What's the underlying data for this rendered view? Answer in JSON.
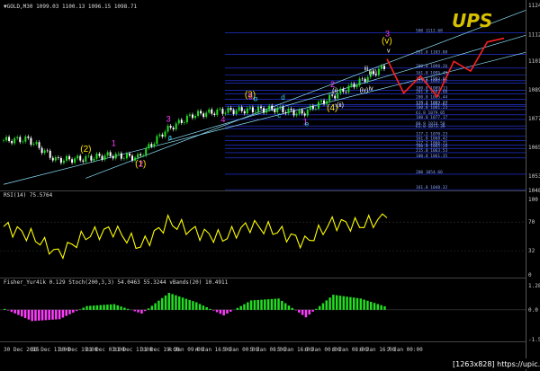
{
  "header": {
    "symbol": "▼GOLD,M30 1099.03 1100.13 1096.15 1098.71"
  },
  "logo": "UPS",
  "watermark": "[1263x828] https://upic.me",
  "colors": {
    "background": "#000000",
    "candle_up": "#22dd22",
    "candle_down": "#ffffff",
    "channel": "#8fe4ff",
    "fib_lines": "#2a3cff",
    "forecast": "#ff2020",
    "rsi_line": "#ffff00",
    "wave_yellow": "#ffe100",
    "wave_magenta": "#ff3cff",
    "wave_cyan": "#3fd3ff"
  },
  "price_axis": [
    "1124.0",
    "1112.1",
    "1101.2",
    "1089.4",
    "1077.6",
    "1065.7",
    "1053.9",
    "1048.0"
  ],
  "rsi_axis": [
    "100",
    "70",
    "32",
    "0"
  ],
  "stoch_axis": [
    "1.284",
    "0.0",
    "-1.584"
  ],
  "time_axis": [
    "30 Dec 2015",
    "30 Dec 11:00",
    "30 Dec 19:00",
    "31 Dec 03:00",
    "31 Dec 11:00",
    "31 Dec 19:00",
    "4 Jan 09:00",
    "4 Jan 16:00",
    "5 Jan 00:00",
    "5 Jan 08:00",
    "5 Jan 16:00",
    "6 Jan 00:00",
    "6 Jan 08:00",
    "6 Jan 16:00",
    "7 Jan 00:00"
  ],
  "indicator_labels": {
    "rsi": "RSI(14) 75.5764",
    "fisher": "Fisher_Yur4ik 0.129  Stoch(200,3,3) 54.0463  55.3244  vBands(20) 10.4911"
  },
  "fib_levels": [
    "500 1112.68",
    "261.8 1103.88",
    "200.0 1098.26",
    "161.8 1095.45",
    "138.2 1093.07",
    "123.6 1092.02",
    "100.0 1089.13",
    "261.8 1087.60",
    "200.0 1085.44",
    "138.2 1083.27",
    "123.6 1082.62",
    "100.0 1081.23",
    "61.8 1079.05",
    "100.0 1077.17",
    "80.9 1074.50",
    "61.8 1073.39",
    "127.2 1070.23",
    "161.8 1068.42",
    "127.2 1066.71",
    "100.0 1065.26",
    "215.0 1063.53",
    "100.0 1061.35",
    "200 1054.66",
    "161.8 1048.32"
  ],
  "wave_labels": {
    "yellow": [
      "(1)",
      "(2)",
      "(3)",
      "(4)",
      "(v)"
    ],
    "magenta": [
      "1",
      "2",
      "3",
      "4",
      "5",
      "1",
      "2",
      "3"
    ],
    "cyan": [
      "a",
      "b",
      "c",
      "d",
      "e"
    ],
    "white": [
      "(i)",
      "(ii)",
      "(iii)",
      "(iv)",
      "iii",
      "iv",
      "v"
    ]
  },
  "chart_data": [
    {
      "type": "line",
      "title": "GOLD,M30",
      "xlabel": "",
      "ylabel": "",
      "ylim": [
        1048,
        1124
      ],
      "x": [
        "30 Dec 2015",
        "30 Dec 11:00",
        "30 Dec 19:00",
        "31 Dec 03:00",
        "31 Dec 11:00",
        "31 Dec 19:00",
        "4 Jan 09:00",
        "4 Jan 16:00",
        "5 Jan 00:00",
        "5 Jan 08:00",
        "5 Jan 16:00",
        "6 Jan 00:00",
        "6 Jan 08:00",
        "6 Jan 16:00",
        "7 Jan 00:00"
      ],
      "close": [
        1068.5,
        1069.0,
        1060.5,
        1061.0,
        1062.5,
        1061.5,
        1072.5,
        1079.0,
        1080.5,
        1081.0,
        1081.5,
        1079.5,
        1086.0,
        1092.0,
        1098.7
      ],
      "forecast_path": [
        1102.0,
        1088.0,
        1095.0,
        1086.5,
        1101.0,
        1097.0,
        1109.0,
        1110.5
      ]
    },
    {
      "type": "line",
      "title": "RSI(14)",
      "ylim": [
        0,
        100
      ],
      "values": [
        64,
        52,
        28,
        52,
        60,
        38,
        70,
        57,
        49,
        66,
        58,
        43,
        69,
        66,
        75.6
      ]
    },
    {
      "type": "bar",
      "title": "Fisher_Yur4ik",
      "ylim": [
        -1.584,
        1.284
      ],
      "values": [
        0.05,
        -0.6,
        -0.5,
        0.2,
        0.3,
        -0.2,
        0.9,
        0.4,
        -0.3,
        0.5,
        0.6,
        -0.4,
        0.8,
        0.6,
        0.129
      ]
    }
  ]
}
